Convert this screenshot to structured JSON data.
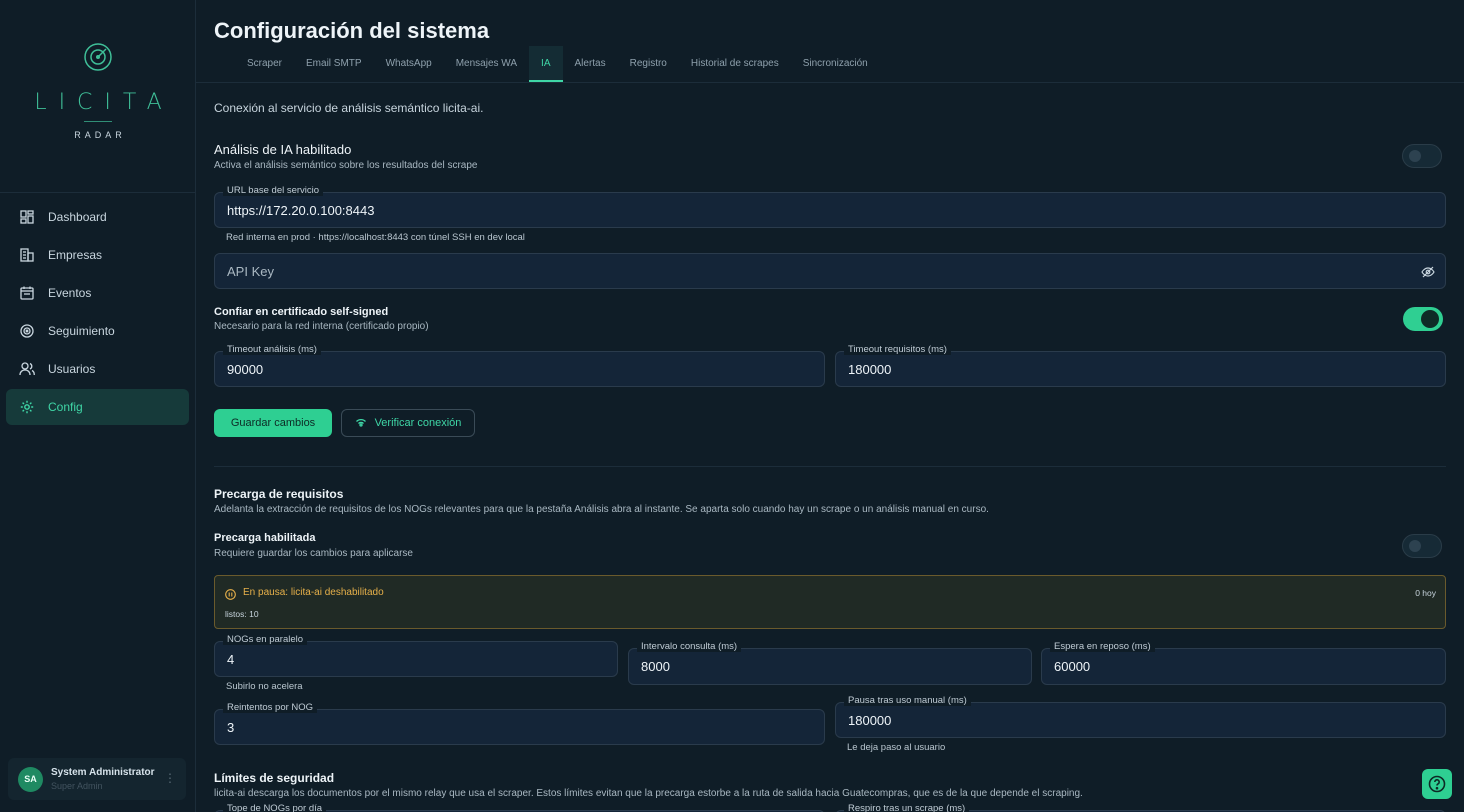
{
  "brand": {
    "name": "LICITA",
    "sub": "RADAR"
  },
  "sidebar": {
    "items": [
      {
        "label": "Dashboard",
        "icon": "dashboard-icon"
      },
      {
        "label": "Empresas",
        "icon": "building-icon"
      },
      {
        "label": "Eventos",
        "icon": "calendar-icon"
      },
      {
        "label": "Seguimiento",
        "icon": "radar-icon"
      },
      {
        "label": "Usuarios",
        "icon": "users-icon"
      },
      {
        "label": "Config",
        "icon": "gear-icon",
        "active": true
      }
    ],
    "user": {
      "initials": "SA",
      "name": "System Administrator",
      "role": "Super Admin",
      "menu": "⋮"
    }
  },
  "page": {
    "title": "Configuración del sistema"
  },
  "tabs": [
    "Scraper",
    "Email SMTP",
    "WhatsApp",
    "Mensajes WA",
    "IA",
    "Alertas",
    "Registro",
    "Historial de scrapes",
    "Sincronización"
  ],
  "active_tab": "IA",
  "ia": {
    "intro": "Conexión al servicio de análisis semántico licita-ai.",
    "enabled": {
      "title": "Análisis de IA habilitado",
      "desc": "Activa el análisis semántico sobre los resultados del scrape",
      "on": false
    },
    "base_url": {
      "label": "URL base del servicio",
      "value": "https://172.20.0.100:8443",
      "hint": "Red interna en prod · https://localhost:8443 con túnel SSH en dev local"
    },
    "api_key": {
      "placeholder": "API Key",
      "value": ""
    },
    "self_signed": {
      "title": "Confiar en certificado self-signed",
      "desc": "Necesario para la red interna (certificado propio)",
      "on": true
    },
    "timeout_analysis": {
      "label": "Timeout análisis (ms)",
      "value": "90000"
    },
    "timeout_requirements": {
      "label": "Timeout requisitos (ms)",
      "value": "180000"
    },
    "save_label": "Guardar cambios",
    "verify_label": "Verificar conexión"
  },
  "precarga": {
    "title": "Precarga de requisitos",
    "desc": "Adelanta la extracción de requisitos de los NOGs relevantes para que la pestaña Análisis abra al instante. Se aparta solo cuando hay un scrape o un análisis manual en curso.",
    "enabled": {
      "title": "Precarga habilitada",
      "desc": "Requiere guardar los cambios para aplicarse",
      "on": false
    },
    "status": {
      "text": "En pausa: licita-ai deshabilitado",
      "count": "0 hoy",
      "ready": "listos: 10"
    },
    "parallel": {
      "label": "NOGs en paralelo",
      "value": "4",
      "hint": "Subirlo no acelera"
    },
    "interval": {
      "label": "Intervalo consulta (ms)",
      "value": "8000"
    },
    "idle": {
      "label": "Espera en reposo (ms)",
      "value": "60000"
    },
    "retries": {
      "label": "Reintentos por NOG",
      "value": "3"
    },
    "pause_manual": {
      "label": "Pausa tras uso manual (ms)",
      "value": "180000",
      "hint": "Le deja paso al usuario"
    }
  },
  "limits": {
    "title": "Límites de seguridad",
    "desc": "licita-ai descarga los documentos por el mismo relay que usa el scraper. Estos límites evitan que la precarga estorbe a la ruta de salida hacia Guatecompras, que es de la que depende el scraping.",
    "daily_cap_label": "Tope de NOGs por día",
    "post_scrape_label": "Respiro tras un scrape (ms)"
  }
}
